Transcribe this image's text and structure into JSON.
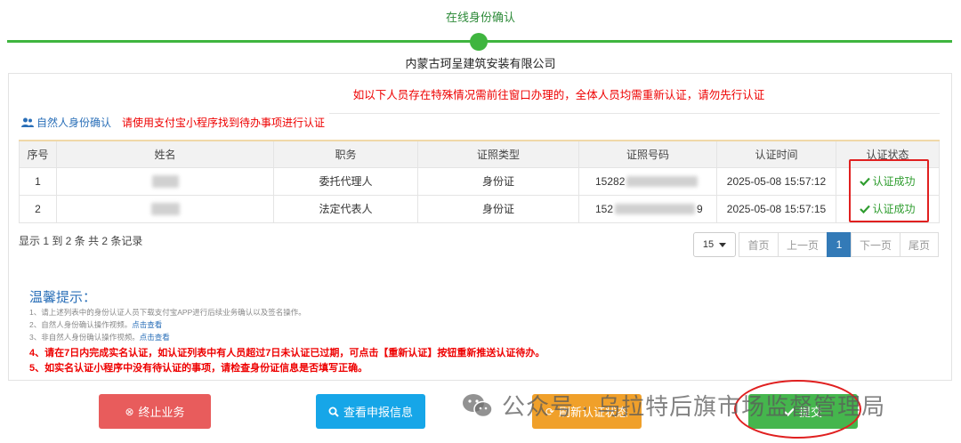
{
  "header": {
    "step_title": "在线身份确认",
    "company": "内蒙古珂呈建筑安装有限公司"
  },
  "notice": "如以下人员存在特殊情况需前往窗口办理的，全体人员均需重新认证，请勿先行认证",
  "section": {
    "title": "自然人身份确认",
    "note": "请使用支付宝小程序找到待办事项进行认证",
    "icon": "users-icon"
  },
  "table": {
    "headers": [
      "序号",
      "姓名",
      "职务",
      "证照类型",
      "证照号码",
      "认证时间",
      "认证状态"
    ],
    "rows": [
      {
        "no": "1",
        "role": "委托代理人",
        "id_type": "身份证",
        "id_prefix": "15282",
        "id_suffix": "",
        "time": "2025-05-08 15:57:12",
        "status": "认证成功"
      },
      {
        "no": "2",
        "role": "法定代表人",
        "id_type": "身份证",
        "id_prefix": "152",
        "id_suffix": "9",
        "time": "2025-05-08 15:57:15",
        "status": "认证成功"
      }
    ]
  },
  "pagination": {
    "summary": "显示 1 到 2 条 共 2 条记录",
    "page_size": "15",
    "first": "首页",
    "prev": "上一页",
    "current": "1",
    "next": "下一页",
    "last": "尾页"
  },
  "tips": {
    "title": "温馨提示：",
    "line1": "1、请上述列表中的身份认证人员下载支付宝APP进行后续业务确认以及签名操作。",
    "line2": "2、自然人身份确认操作视频。",
    "line2_link": "点击查看",
    "line3": "3、非自然人身份确认操作视频。",
    "line3_link": "点击查看",
    "line4": "4、请在7日内完成实名认证，如认证列表中有人员超过7日未认证已过期，可点击【重新认证】按钮重新推送认证待办。",
    "line5": "5、如实名认证小程序中没有待认证的事项，请检查身份证信息是否填写正确。"
  },
  "buttons": {
    "stop": "终止业务",
    "view": "查看申报信息",
    "refresh": "刷新认证状态",
    "submit": "提交"
  },
  "watermark": {
    "text": "公众号 · 乌拉特后旗市场监督管理局"
  },
  "colors": {
    "accent_green": "#3fb53f",
    "link_blue": "#2a6fb8",
    "alert_red": "#e00000",
    "btn_stop": "#e85c5c",
    "btn_view": "#16a6e8",
    "btn_refresh": "#f0a02a",
    "btn_submit": "#45b64d"
  }
}
